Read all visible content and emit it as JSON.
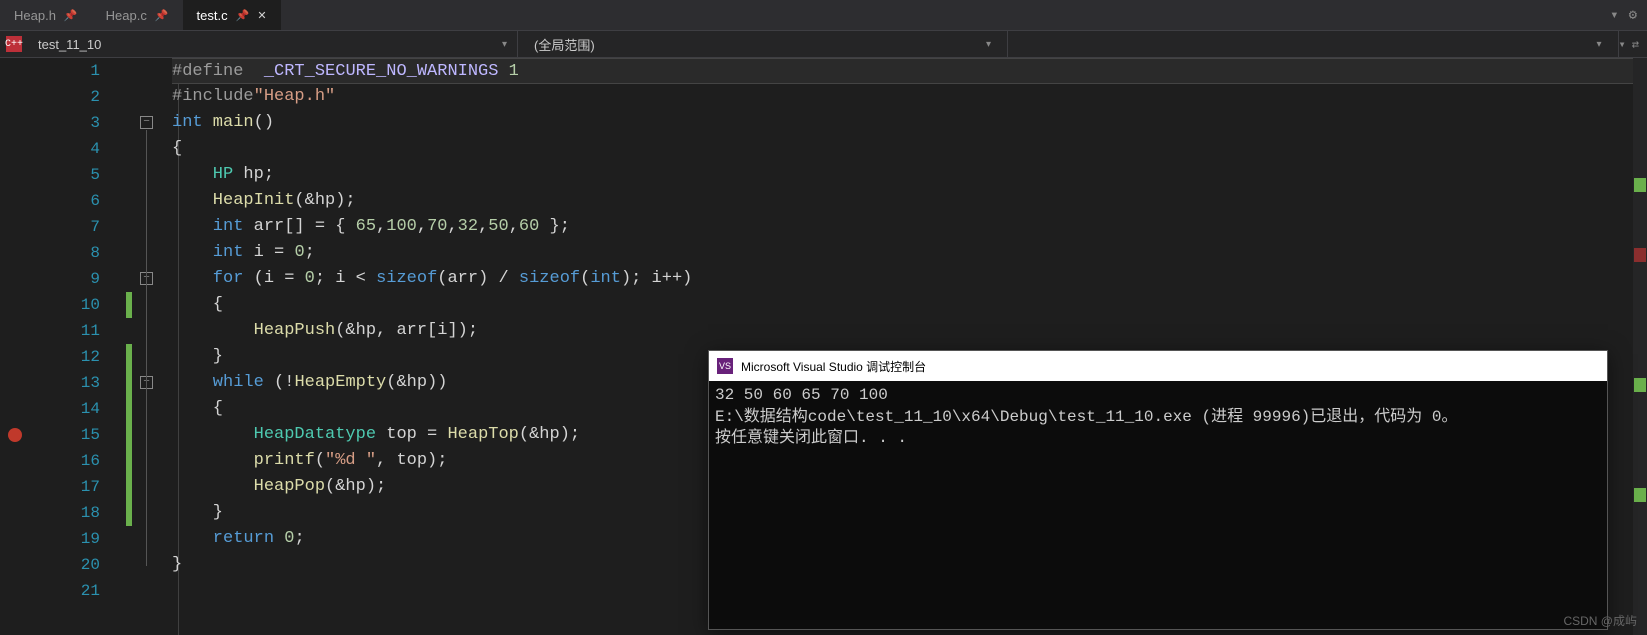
{
  "tabs": [
    {
      "label": "Heap.h",
      "pinned": true,
      "active": false
    },
    {
      "label": "Heap.c",
      "pinned": true,
      "active": false
    },
    {
      "label": "test.c",
      "pinned": true,
      "active": true
    }
  ],
  "nav": {
    "project": "test_11_10",
    "scope": "(全局范围)"
  },
  "code": {
    "lines": [
      "1",
      "2",
      "3",
      "4",
      "5",
      "6",
      "7",
      "8",
      "9",
      "10",
      "11",
      "12",
      "13",
      "14",
      "15",
      "16",
      "17",
      "18",
      "19",
      "20",
      "21"
    ]
  },
  "console": {
    "title": "Microsoft Visual Studio 调试控制台",
    "line1": "32 50 60 65 70 100",
    "line2": "E:\\数据结构code\\test_11_10\\x64\\Debug\\test_11_10.exe (进程 99996)已退出，代码为 0。",
    "line3": "按任意键关闭此窗口. . ."
  },
  "src": {
    "l1a": "#define",
    "l1b": "  _CRT_SECURE_NO_WARNINGS",
    "l1c": " 1",
    "l2a": "#include",
    "l2b": "\"Heap.h\"",
    "l3a": "int",
    "l3b": " main",
    "l3c": "()",
    "l4": "{",
    "l5a": "    HP",
    "l5b": " hp;",
    "l6a": "    HeapInit",
    "l6b": "(&hp);",
    "l7a": "    int",
    "l7b": " arr[] = { ",
    "l7c": "65",
    "l7d": ",",
    "l7e": "100",
    "l7f": ",",
    "l7g": "70",
    "l7h": ",",
    "l7i": "32",
    "l7j": ",",
    "l7k": "50",
    "l7l": ",",
    "l7m": "60",
    "l7n": " };",
    "l8a": "    int",
    "l8b": " i = ",
    "l8c": "0",
    "l8d": ";",
    "l9a": "    for",
    "l9b": " (i = ",
    "l9c": "0",
    "l9d": "; i < ",
    "l9e": "sizeof",
    "l9f": "(arr) / ",
    "l9g": "sizeof",
    "l9h": "(",
    "l9i": "int",
    "l9j": "); i++)",
    "l10": "    {",
    "l11a": "        HeapPush",
    "l11b": "(&hp, arr[i]);",
    "l12": "    }",
    "l13a": "    while",
    "l13b": " (!",
    "l13c": "HeapEmpty",
    "l13d": "(&hp))",
    "l14": "    {",
    "l15a": "        HeapDatatype",
    "l15b": " top = ",
    "l15c": "HeapTop",
    "l15d": "(&hp);",
    "l16a": "        printf",
    "l16b": "(",
    "l16c": "\"%d \"",
    "l16d": ", top);",
    "l17a": "        HeapPop",
    "l17b": "(&hp);",
    "l18": "    }",
    "l19a": "    return",
    "l19b": " 0",
    "l19c": ";",
    "l20": "}"
  },
  "watermark": "CSDN @成屿"
}
